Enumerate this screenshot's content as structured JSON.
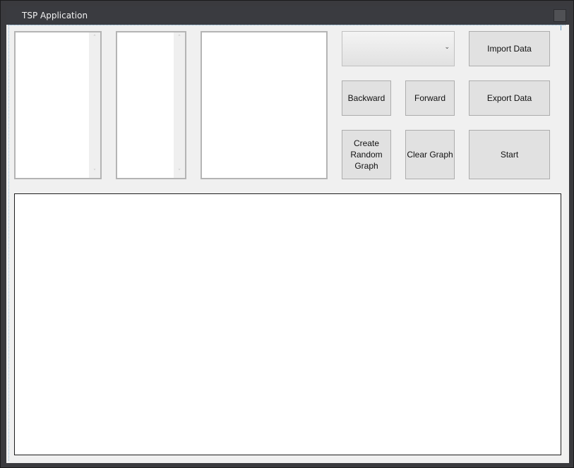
{
  "window": {
    "title": "TSP Application"
  },
  "listboxes": {
    "up_arrow": "˄",
    "down_arrow": "˅"
  },
  "combo": {
    "selected": "",
    "arrow_glyph": "⌄"
  },
  "buttons": {
    "import_data": "Import Data",
    "backward": "Backward",
    "forward": "Forward",
    "export_data": "Export Data",
    "create_random_graph": "Create\nRandom\nGraph",
    "clear_graph": "Clear Graph",
    "start": "Start"
  }
}
